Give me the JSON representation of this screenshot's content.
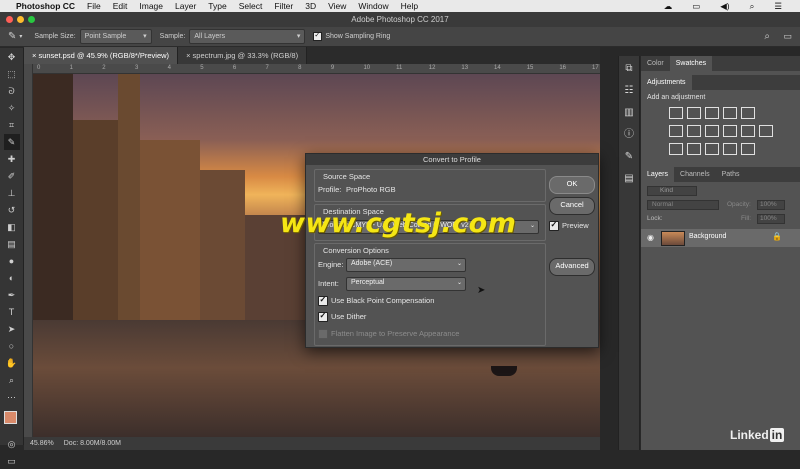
{
  "menubar": {
    "app_name": "Photoshop CC",
    "items": [
      "File",
      "Edit",
      "Image",
      "Layer",
      "Type",
      "Select",
      "Filter",
      "3D",
      "View",
      "Window",
      "Help"
    ]
  },
  "window": {
    "title": "Adobe Photoshop CC 2017"
  },
  "options_bar": {
    "sample_size_label": "Sample Size:",
    "sample_size_value": "Point Sample",
    "sample_label": "Sample:",
    "sample_value": "All Layers",
    "show_sampling_ring_label": "Show Sampling Ring",
    "show_sampling_ring_checked": true
  },
  "tabs": [
    {
      "label": "sunset.psd @ 45.9% (RGB/8*/Preview)",
      "active": true
    },
    {
      "label": "spectrum.jpg @ 33.3% (RGB/8)",
      "active": false
    }
  ],
  "ruler_ticks": [
    "0",
    "1",
    "2",
    "3",
    "4",
    "5",
    "6",
    "7",
    "8",
    "9",
    "10",
    "11",
    "12",
    "13",
    "14",
    "15",
    "16",
    "17"
  ],
  "status": {
    "zoom": "45.86%",
    "doc": "Doc: 8.00M/8.00M"
  },
  "panels": {
    "top_tabs": [
      "Color",
      "Swatches"
    ],
    "adjustments_title": "Adjustments",
    "add_adjustment": "Add an adjustment",
    "layer_tabs": [
      "Layers",
      "Channels",
      "Paths"
    ],
    "kind_placeholder": "Kind",
    "blend_mode": "Normal",
    "opacity_label": "Opacity:",
    "opacity_value": "100%",
    "lock_label": "Lock:",
    "fill_label": "Fill:",
    "fill_value": "100%",
    "layer_name": "Background"
  },
  "dialog": {
    "title": "Convert to Profile",
    "source_space_title": "Source Space",
    "profile_label": "Profile:",
    "profile_value": "ProPhoto RGB",
    "destination_space_title": "Destination Space",
    "destination_profile": "Working CMYK - U.S. Web Coated (SWOP) v2",
    "conversion_options_title": "Conversion Options",
    "engine_label": "Engine:",
    "engine_value": "Adobe (ACE)",
    "intent_label": "Intent:",
    "intent_value": "Perceptual",
    "black_point_label": "Use Black Point Compensation",
    "black_point_checked": true,
    "dither_label": "Use Dither",
    "dither_checked": true,
    "flatten_label": "Flatten Image to Preserve Appearance",
    "flatten_checked": false,
    "ok_label": "OK",
    "cancel_label": "Cancel",
    "preview_label": "Preview",
    "preview_checked": true,
    "advanced_label": "Advanced"
  },
  "watermark": "www.cgtsj.com",
  "brand": {
    "linked": "Linked",
    "in": "in"
  }
}
